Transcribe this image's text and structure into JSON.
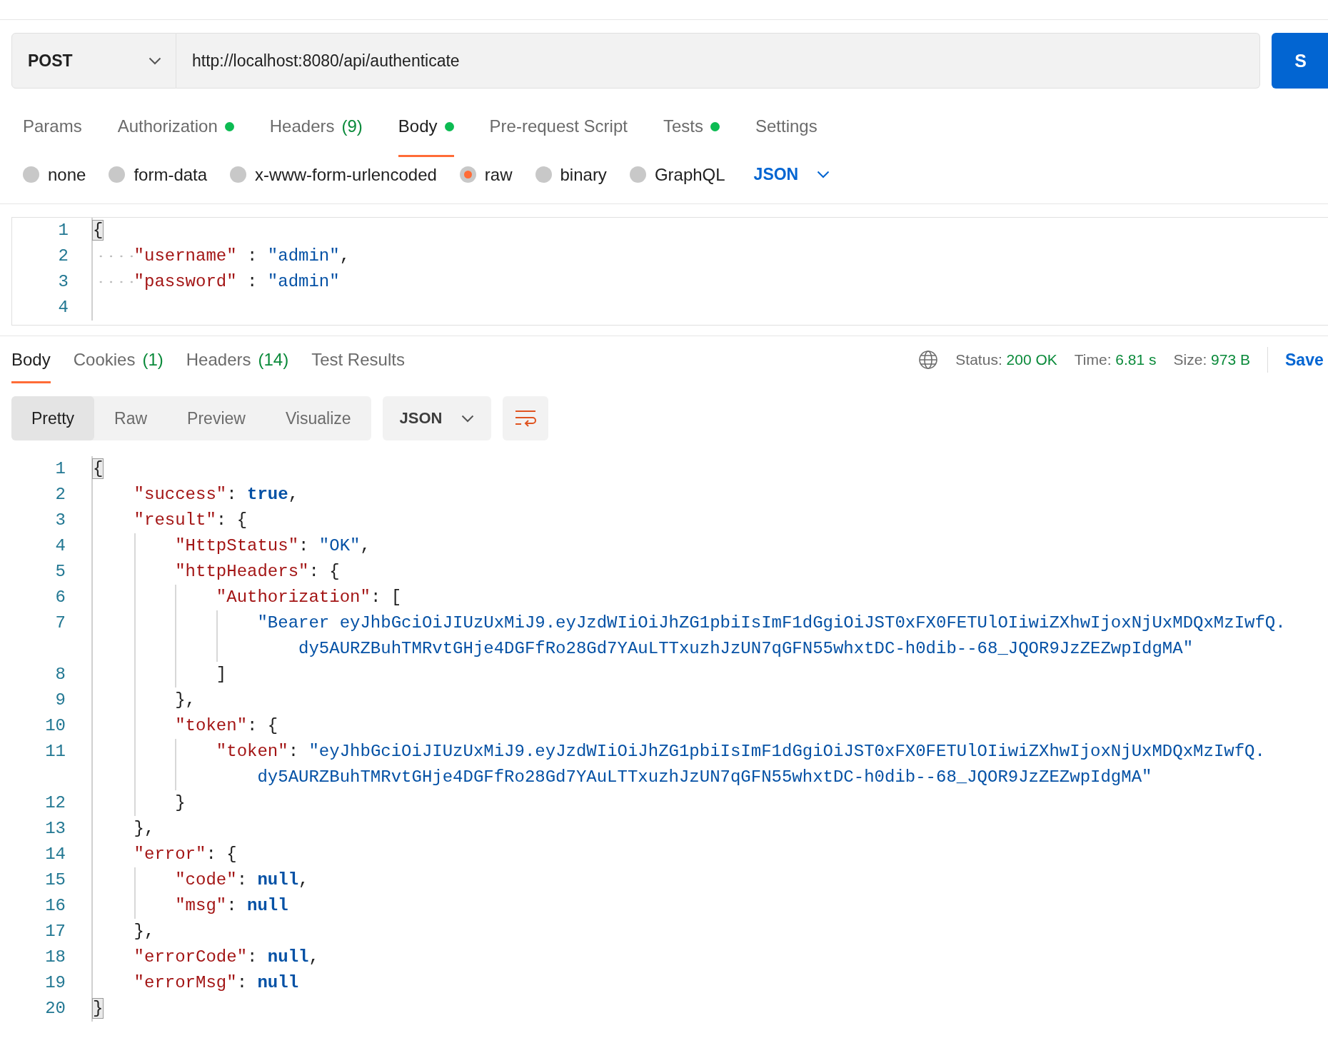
{
  "request": {
    "method": "POST",
    "url": "http://localhost:8080/api/authenticate",
    "send_label": "S"
  },
  "request_tabs": [
    {
      "label": "Params",
      "selected": false,
      "dot": false
    },
    {
      "label": "Authorization",
      "selected": false,
      "dot": true
    },
    {
      "label": "Headers",
      "count": "(9)",
      "selected": false,
      "dot": false
    },
    {
      "label": "Body",
      "selected": true,
      "dot": true
    },
    {
      "label": "Pre-request Script",
      "selected": false,
      "dot": false
    },
    {
      "label": "Tests",
      "selected": false,
      "dot": true
    },
    {
      "label": "Settings",
      "selected": false,
      "dot": false
    }
  ],
  "body_types": [
    {
      "label": "none",
      "selected": false
    },
    {
      "label": "form-data",
      "selected": false
    },
    {
      "label": "x-www-form-urlencoded",
      "selected": false
    },
    {
      "label": "raw",
      "selected": true
    },
    {
      "label": "binary",
      "selected": false
    },
    {
      "label": "GraphQL",
      "selected": false
    }
  ],
  "body_format": "JSON",
  "request_body": [
    {
      "number": "1",
      "tokens": [
        {
          "kind": "match",
          "text": "{"
        }
      ]
    },
    {
      "number": "2",
      "tokens": [
        {
          "kind": "key",
          "text": "    \"username\""
        },
        {
          "kind": "punct",
          "text": " : "
        },
        {
          "kind": "str",
          "text": "\"admin\""
        },
        {
          "kind": "punct",
          "text": ","
        }
      ]
    },
    {
      "number": "3",
      "tokens": [
        {
          "kind": "key",
          "text": "    \"password\""
        },
        {
          "kind": "punct",
          "text": " : "
        },
        {
          "kind": "str",
          "text": "\"admin\""
        }
      ]
    },
    {
      "number": "4"
    }
  ],
  "response_tabs": [
    {
      "label": "Body",
      "selected": true
    },
    {
      "label": "Cookies",
      "count": "(1)",
      "selected": false
    },
    {
      "label": "Headers",
      "count": "(14)",
      "selected": false
    },
    {
      "label": "Test Results",
      "selected": false
    }
  ],
  "stats": [
    {
      "label": "Status:",
      "value": "200 OK"
    },
    {
      "label": "Time:",
      "value": "6.81 s"
    },
    {
      "label": "Size:",
      "value": "973 B"
    }
  ],
  "save_label": "Save",
  "view_modes": [
    {
      "label": "Pretty",
      "selected": true
    },
    {
      "label": "Raw",
      "selected": false
    },
    {
      "label": "Preview",
      "selected": false
    },
    {
      "label": "Visualize",
      "selected": false
    }
  ],
  "response_format": "JSON",
  "response_body": [
    {
      "number": "1",
      "tokens": [
        {
          "kind": "match",
          "text": "{"
        }
      ]
    },
    {
      "number": "2",
      "tokens": [
        {
          "kind": "key",
          "text": "    \"success\""
        },
        {
          "kind": "punct",
          "text": ": "
        },
        {
          "kind": "kw",
          "text": "true"
        },
        {
          "kind": "punct",
          "text": ","
        }
      ]
    },
    {
      "number": "3",
      "tokens": [
        {
          "kind": "key",
          "text": "    \"result\""
        },
        {
          "kind": "punct",
          "text": ": {"
        }
      ]
    },
    {
      "number": "4",
      "tokens": [
        {
          "kind": "key",
          "text": "        \"HttpStatus\""
        },
        {
          "kind": "punct",
          "text": ": "
        },
        {
          "kind": "str",
          "text": "\"OK\""
        },
        {
          "kind": "punct",
          "text": ","
        }
      ]
    },
    {
      "number": "5",
      "tokens": [
        {
          "kind": "key",
          "text": "        \"httpHeaders\""
        },
        {
          "kind": "punct",
          "text": ": {"
        }
      ]
    },
    {
      "number": "6",
      "tokens": [
        {
          "kind": "key",
          "text": "            \"Authorization\""
        },
        {
          "kind": "punct",
          "text": ": ["
        }
      ]
    },
    {
      "number": "7",
      "tokens": [
        {
          "kind": "str",
          "text": "                \"Bearer eyJhbGciOiJIUzUxMiJ9.eyJzdWIiOiJhZG1pbiIsImF1dGgiOiJST0xFX0FETUlOIiwiZXhwIjoxNjUxMDQxMzIwfQ."
        }
      ],
      "wrap": [
        {
          "kind": "str",
          "text": "                    dy5AURZBuhTMRvtGHje4DGFfRo28Gd7YAuLTTxuzhJzUN7qGFN55whxtDC-h0dib--68_JQOR9JzZEZwpIdgMA\""
        }
      ]
    },
    {
      "number": "8",
      "tokens": [
        {
          "kind": "punct",
          "text": "            ]"
        }
      ]
    },
    {
      "number": "9",
      "tokens": [
        {
          "kind": "punct",
          "text": "        },"
        }
      ]
    },
    {
      "number": "10",
      "tokens": [
        {
          "kind": "key",
          "text": "        \"token\""
        },
        {
          "kind": "punct",
          "text": ": {"
        }
      ]
    },
    {
      "number": "11",
      "tokens": [
        {
          "kind": "key",
          "text": "            \"token\""
        },
        {
          "kind": "punct",
          "text": ": "
        },
        {
          "kind": "str",
          "text": "\"eyJhbGciOiJIUzUxMiJ9.eyJzdWIiOiJhZG1pbiIsImF1dGgiOiJST0xFX0FETUlOIiwiZXhwIjoxNjUxMDQxMzIwfQ."
        }
      ],
      "wrap": [
        {
          "kind": "str",
          "text": "                dy5AURZBuhTMRvtGHje4DGFfRo28Gd7YAuLTTxuzhJzUN7qGFN55whxtDC-h0dib--68_JQOR9JzZEZwpIdgMA\""
        }
      ]
    },
    {
      "number": "12",
      "tokens": [
        {
          "kind": "punct",
          "text": "        }"
        }
      ]
    },
    {
      "number": "13",
      "tokens": [
        {
          "kind": "punct",
          "text": "    },"
        }
      ]
    },
    {
      "number": "14",
      "tokens": [
        {
          "kind": "key",
          "text": "    \"error\""
        },
        {
          "kind": "punct",
          "text": ": {"
        }
      ]
    },
    {
      "number": "15",
      "tokens": [
        {
          "kind": "key",
          "text": "        \"code\""
        },
        {
          "kind": "punct",
          "text": ": "
        },
        {
          "kind": "kw",
          "text": "null"
        },
        {
          "kind": "punct",
          "text": ","
        }
      ]
    },
    {
      "number": "16",
      "tokens": [
        {
          "kind": "key",
          "text": "        \"msg\""
        },
        {
          "kind": "punct",
          "text": ": "
        },
        {
          "kind": "kw",
          "text": "null"
        }
      ]
    },
    {
      "number": "17",
      "tokens": [
        {
          "kind": "punct",
          "text": "    },"
        }
      ]
    },
    {
      "number": "18",
      "tokens": [
        {
          "kind": "key",
          "text": "    \"errorCode\""
        },
        {
          "kind": "punct",
          "text": ": "
        },
        {
          "kind": "kw",
          "text": "null"
        },
        {
          "kind": "punct",
          "text": ","
        }
      ]
    },
    {
      "number": "19",
      "tokens": [
        {
          "kind": "key",
          "text": "    \"errorMsg\""
        },
        {
          "kind": "punct",
          "text": ": "
        },
        {
          "kind": "kw",
          "text": "null"
        }
      ]
    },
    {
      "number": "20",
      "tokens": [
        {
          "kind": "match",
          "text": "}"
        }
      ]
    }
  ]
}
